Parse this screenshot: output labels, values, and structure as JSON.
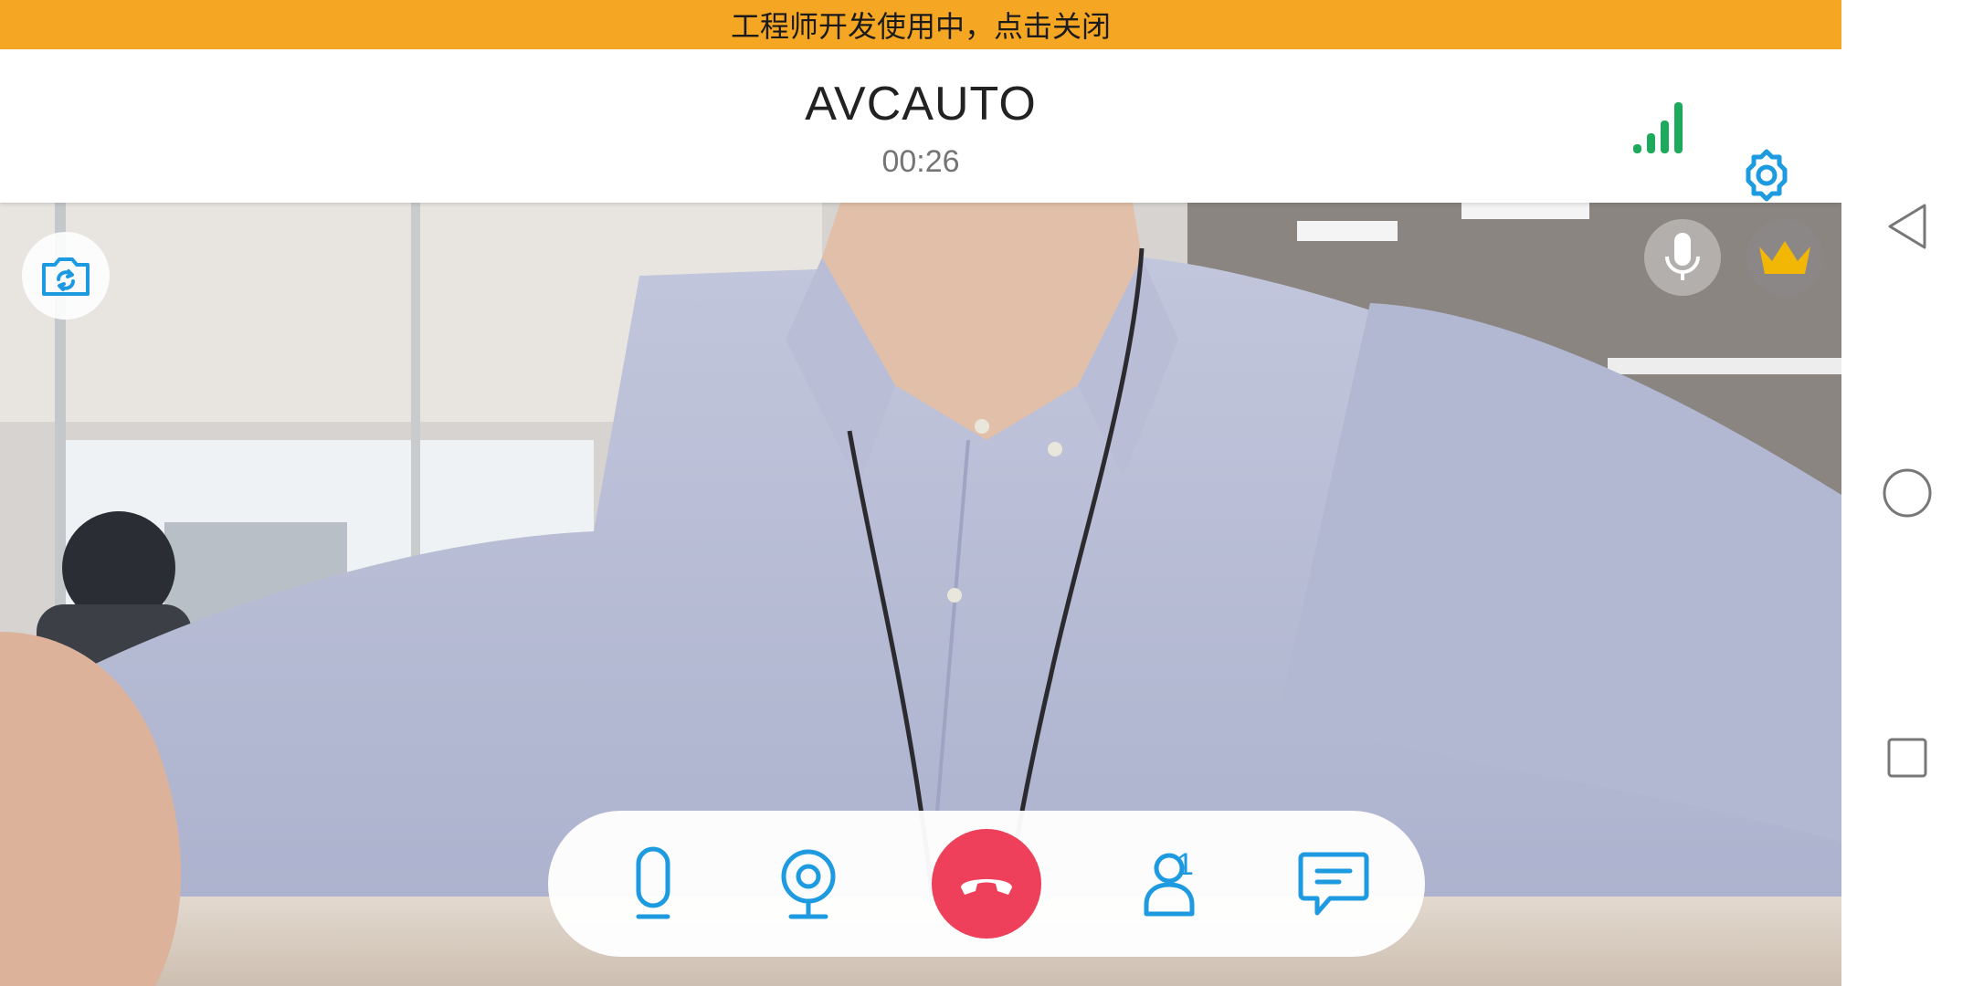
{
  "banner": {
    "text": "工程师开发使用中，点击关闭"
  },
  "header": {
    "contact_name": "AVCAUTO",
    "timer": "00:26",
    "signal_icon": "signal-strength-icon",
    "settings_icon": "gear-icon"
  },
  "video": {
    "switch_camera_icon": "camera-switch-icon",
    "mic_status_icon": "microphone-icon",
    "host_badge_icon": "crown-icon"
  },
  "controls": {
    "mic_icon": "microphone-icon",
    "camera_icon": "webcam-icon",
    "hangup_icon": "phone-hangup-icon",
    "participants_icon": "person-icon",
    "participant_count": "1",
    "chat_icon": "chat-bubble-icon"
  },
  "colors": {
    "banner": "#F5A623",
    "accent": "#1E9BE0",
    "hangup": "#EE3F5B",
    "signal": "#1DAA5C",
    "crown": "#F2B705"
  },
  "system_nav": [
    "back",
    "home",
    "recent-apps"
  ]
}
